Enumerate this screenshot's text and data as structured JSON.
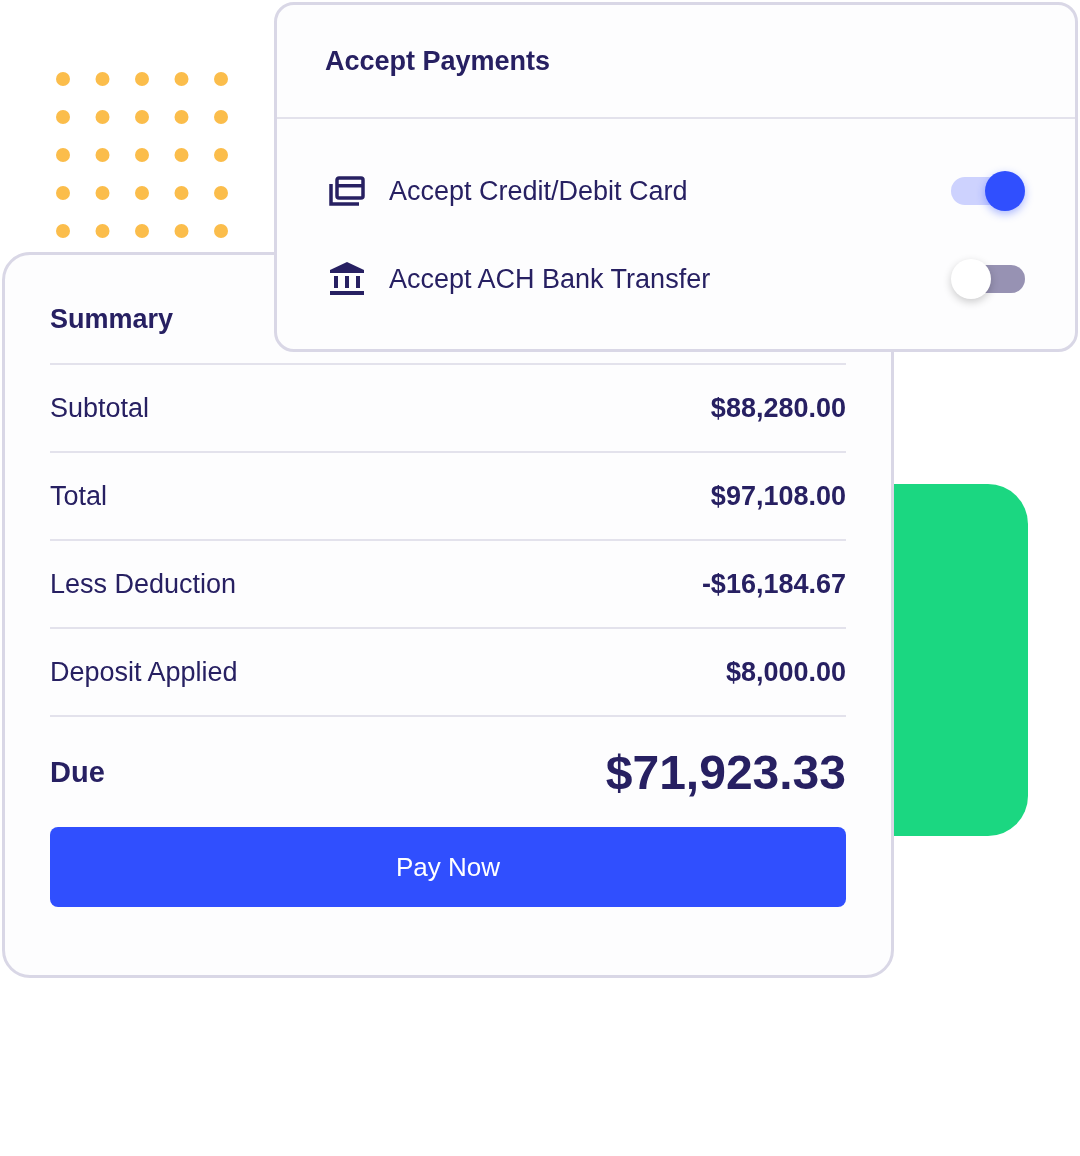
{
  "payments": {
    "title": "Accept Payments",
    "options": [
      {
        "kind": "card",
        "label": "Accept Credit/Debit Card",
        "on": true
      },
      {
        "kind": "bank",
        "label": "Accept ACH Bank Transfer",
        "on": false
      }
    ]
  },
  "summary": {
    "title": "Summary",
    "rows": [
      {
        "label": "Subtotal",
        "value": "$88,280.00"
      },
      {
        "label": "Total",
        "value": "$97,108.00"
      },
      {
        "label": "Less Deduction",
        "value": "-$16,184.67"
      },
      {
        "label": "Deposit Applied",
        "value": "$8,000.00"
      }
    ],
    "due": {
      "label": "Due",
      "value": "$71,923.33"
    },
    "button": "Pay Now"
  }
}
